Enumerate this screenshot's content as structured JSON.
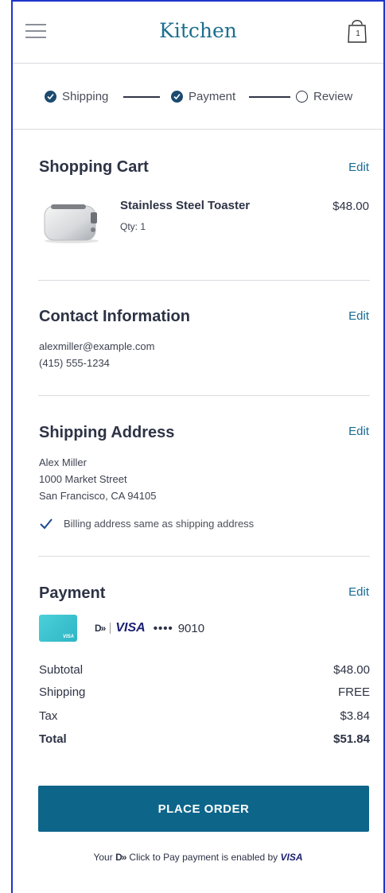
{
  "header": {
    "title": "Kitchen",
    "cart_count": "1"
  },
  "stepper": {
    "steps": [
      {
        "label": "Shipping",
        "state": "done"
      },
      {
        "label": "Payment",
        "state": "done"
      },
      {
        "label": "Review",
        "state": "current"
      }
    ]
  },
  "cart": {
    "title": "Shopping Cart",
    "edit_label": "Edit",
    "item": {
      "name": "Stainless Steel Toaster",
      "qty": "Qty: 1",
      "price": "$48.00"
    }
  },
  "contact": {
    "title": "Contact Information",
    "edit_label": "Edit",
    "email": "alexmiller@example.com",
    "phone": "(415) 555-1234"
  },
  "shipping": {
    "title": "Shipping Address",
    "edit_label": "Edit",
    "name": "Alex Miller",
    "street": "1000 Market Street",
    "city": "San Francisco, CA 94105",
    "billing_note": "Billing address same as shipping address"
  },
  "payment": {
    "title": "Payment",
    "edit_label": "Edit",
    "brand": "VISA",
    "masked": "••••",
    "last4": "9010"
  },
  "summary": {
    "subtotal_label": "Subtotal",
    "subtotal": "$48.00",
    "shipping_label": "Shipping",
    "shipping": "FREE",
    "tax_label": "Tax",
    "tax": "$3.84",
    "total_label": "Total",
    "total": "$51.84"
  },
  "place_order_label": "PLACE ORDER",
  "footer": {
    "prefix": "Your",
    "suffix": "Click to Pay payment is enabled by",
    "brand": "VISA"
  },
  "colors": {
    "accent": "#0e658a",
    "title": "#1b6f8e",
    "link": "#176b91",
    "visa": "#1a1f71"
  },
  "icons": [
    "menu-icon",
    "shopping-bag-icon",
    "check-circle-icon",
    "empty-circle-icon",
    "checkmark-icon",
    "click-to-pay-icon",
    "visa-logo"
  ]
}
